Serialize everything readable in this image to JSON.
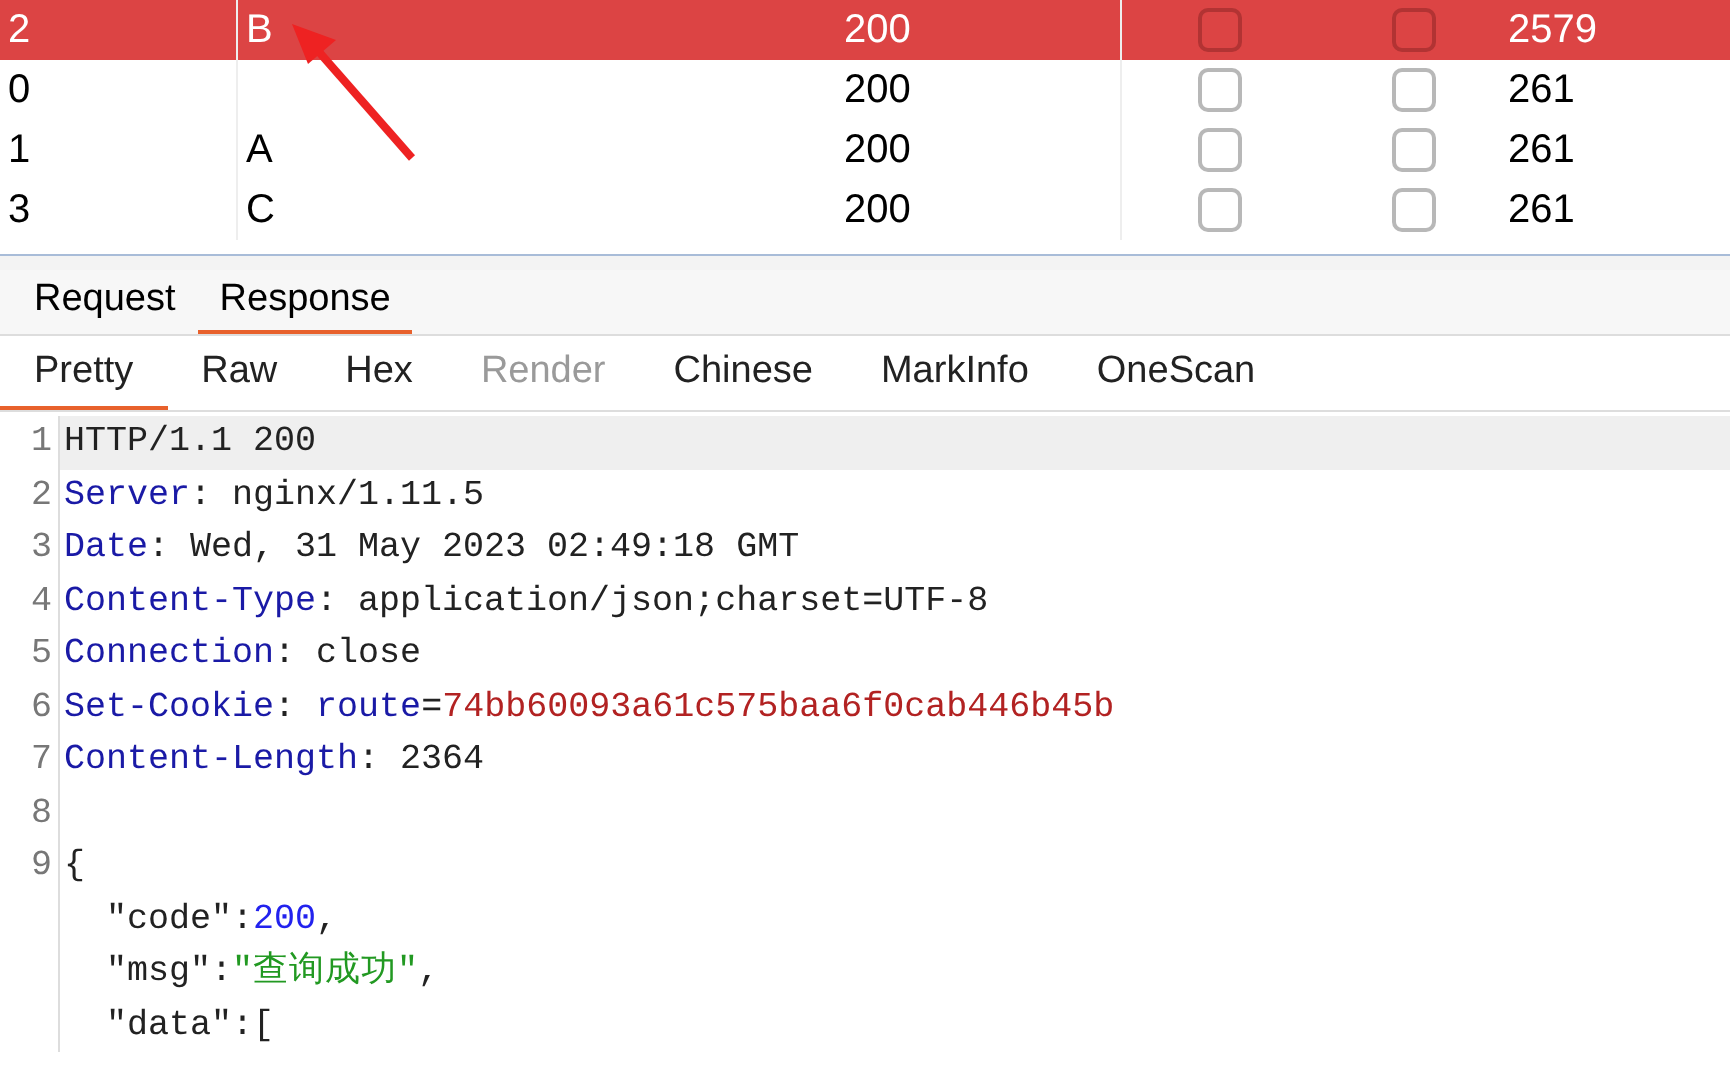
{
  "table": {
    "rows": [
      {
        "selected": true,
        "cells": [
          "2",
          "B",
          "200",
          "",
          "",
          "2579"
        ],
        "checks": [
          false,
          false
        ]
      },
      {
        "selected": false,
        "cells": [
          "0",
          "",
          "200",
          "",
          "",
          "261"
        ],
        "checks": [
          false,
          false
        ]
      },
      {
        "selected": false,
        "cells": [
          "1",
          "A",
          "200",
          "",
          "",
          "261"
        ],
        "checks": [
          false,
          false
        ]
      },
      {
        "selected": false,
        "cells": [
          "3",
          "C",
          "200",
          "",
          "",
          "261"
        ],
        "checks": [
          false,
          false
        ]
      }
    ]
  },
  "annotation": {
    "kind": "arrow"
  },
  "tabs": [
    {
      "label": "Request",
      "selected": false
    },
    {
      "label": "Response",
      "selected": true
    }
  ],
  "subtabs": [
    {
      "label": "Pretty",
      "selected": true,
      "disabled": false
    },
    {
      "label": "Raw",
      "selected": false,
      "disabled": false
    },
    {
      "label": "Hex",
      "selected": false,
      "disabled": false
    },
    {
      "label": "Render",
      "selected": false,
      "disabled": true
    },
    {
      "label": "Chinese",
      "selected": false,
      "disabled": false
    },
    {
      "label": "MarkInfo",
      "selected": false,
      "disabled": false
    },
    {
      "label": "OneScan",
      "selected": false,
      "disabled": false
    }
  ],
  "editor": {
    "lines": [
      {
        "number": "1",
        "highlighted": true,
        "segments": [
          {
            "kind": "plain",
            "text": "HTTP/1.1 200"
          }
        ]
      },
      {
        "number": "2",
        "highlighted": false,
        "segments": [
          {
            "kind": "header",
            "text": "Server"
          },
          {
            "kind": "plain",
            "text": ": nginx/1.11.5"
          }
        ]
      },
      {
        "number": "3",
        "highlighted": false,
        "segments": [
          {
            "kind": "header",
            "text": "Date"
          },
          {
            "kind": "plain",
            "text": ": Wed, 31 May 2023 02:49:18 GMT"
          }
        ]
      },
      {
        "number": "4",
        "highlighted": false,
        "segments": [
          {
            "kind": "header",
            "text": "Content-Type"
          },
          {
            "kind": "plain",
            "text": ": application/json;charset=UTF-8"
          }
        ]
      },
      {
        "number": "5",
        "highlighted": false,
        "segments": [
          {
            "kind": "header",
            "text": "Connection"
          },
          {
            "kind": "plain",
            "text": ": close"
          }
        ]
      },
      {
        "number": "6",
        "highlighted": false,
        "segments": [
          {
            "kind": "header",
            "text": "Set-Cookie"
          },
          {
            "kind": "plain",
            "text": ": "
          },
          {
            "kind": "header",
            "text": "route"
          },
          {
            "kind": "plain",
            "text": "="
          },
          {
            "kind": "cookie",
            "text": "74bb60093a61c575baa6f0cab446b45b"
          }
        ]
      },
      {
        "number": "7",
        "highlighted": false,
        "segments": [
          {
            "kind": "header",
            "text": "Content-Length"
          },
          {
            "kind": "plain",
            "text": ": 2364"
          }
        ]
      },
      {
        "number": "8",
        "highlighted": false
      },
      {
        "number": "9",
        "highlighted": false,
        "segments": [
          {
            "kind": "plain",
            "text": "{"
          }
        ]
      },
      {
        "highlighted": false,
        "segments": [
          {
            "kind": "plain",
            "text": "  \"code\":"
          },
          {
            "kind": "number",
            "text": "200"
          },
          {
            "kind": "plain",
            "text": ","
          }
        ]
      },
      {
        "highlighted": false,
        "segments": [
          {
            "kind": "plain",
            "text": "  \"msg\":"
          },
          {
            "kind": "string",
            "text": "\"查询成功\""
          },
          {
            "kind": "plain",
            "text": ","
          }
        ]
      },
      {
        "highlighted": false,
        "segments": [
          {
            "kind": "plain",
            "text": "  \"data\":["
          }
        ]
      }
    ]
  }
}
